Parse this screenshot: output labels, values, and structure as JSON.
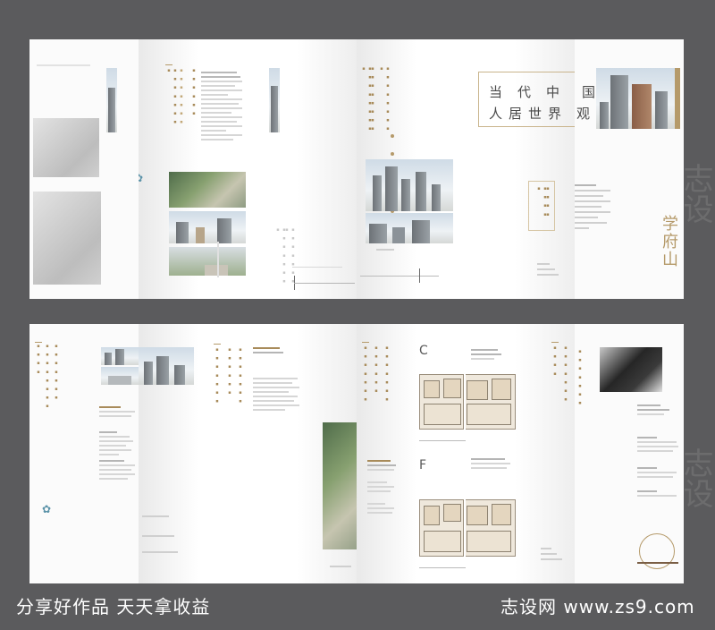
{
  "top": {
    "big_chars_row1": [
      "当",
      "代",
      "中",
      "国"
    ],
    "big_chars_row2": [
      "人",
      "居",
      "世",
      "界",
      "观"
    ],
    "brand": "学府山",
    "icon_p1": "flower-icon"
  },
  "bottom": {
    "icon_p1": "flower-icon"
  },
  "footer": {
    "left": "分享好作品 天天拿收益",
    "right": "志设网 www.zs9.com"
  },
  "watermark": "志设"
}
